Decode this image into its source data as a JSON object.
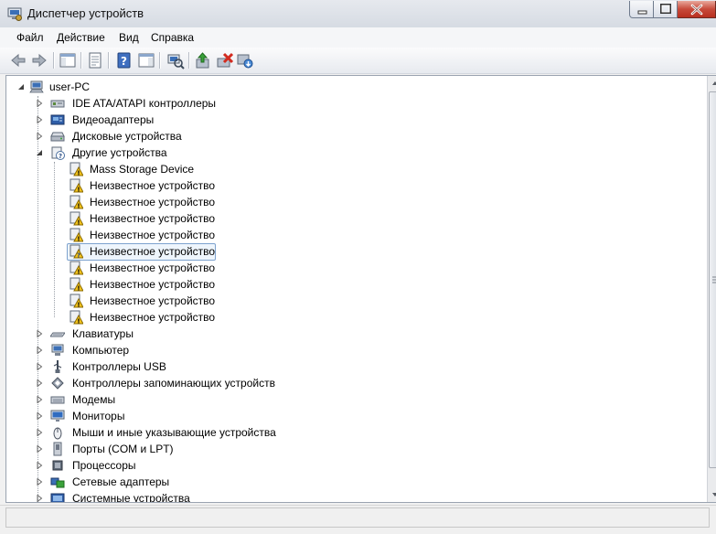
{
  "window": {
    "title": "Диспетчер устройств",
    "accent": "#7da2ce"
  },
  "menu": [
    {
      "label": "Файл"
    },
    {
      "label": "Действие"
    },
    {
      "label": "Вид"
    },
    {
      "label": "Справка"
    }
  ],
  "toolbar": {
    "buttons": [
      {
        "name": "back-button",
        "icon": "arrow-left-icon"
      },
      {
        "name": "forward-button",
        "icon": "arrow-right-icon"
      },
      {
        "name": "show-hide-console-tree-button",
        "icon": "console-tree-icon"
      },
      {
        "name": "properties-button",
        "icon": "properties-icon"
      },
      {
        "name": "help-button",
        "icon": "help-icon"
      },
      {
        "name": "show-action-pane-button",
        "icon": "action-pane-icon"
      },
      {
        "name": "scan-hardware-button",
        "icon": "scan-hardware-icon"
      },
      {
        "name": "update-driver-button",
        "icon": "update-driver-icon"
      },
      {
        "name": "uninstall-button",
        "icon": "uninstall-icon"
      },
      {
        "name": "disable-button",
        "icon": "disable-device-icon"
      }
    ]
  },
  "tree": {
    "root": {
      "label": "user-PC",
      "icon": "computer-icon",
      "expanded": true
    },
    "categories": [
      {
        "label": "IDE ATA/ATAPI контроллеры",
        "icon": "ide-controller-icon",
        "expanded": false
      },
      {
        "label": "Видеоадаптеры",
        "icon": "display-adapter-icon",
        "expanded": false
      },
      {
        "label": "Дисковые устройства",
        "icon": "disk-drive-icon",
        "expanded": false
      },
      {
        "label": "Другие устройства",
        "icon": "unknown-device-icon",
        "expanded": true,
        "children": [
          {
            "label": "Mass Storage Device",
            "icon": "warning-device-icon"
          },
          {
            "label": "Неизвестное устройство",
            "icon": "warning-device-icon"
          },
          {
            "label": "Неизвестное устройство",
            "icon": "warning-device-icon"
          },
          {
            "label": "Неизвестное устройство",
            "icon": "warning-device-icon"
          },
          {
            "label": "Неизвестное устройство",
            "icon": "warning-device-icon"
          },
          {
            "label": "Неизвестное устройство",
            "icon": "warning-device-icon",
            "selected": true
          },
          {
            "label": "Неизвестное устройство",
            "icon": "warning-device-icon"
          },
          {
            "label": "Неизвестное устройство",
            "icon": "warning-device-icon"
          },
          {
            "label": "Неизвестное устройство",
            "icon": "warning-device-icon"
          },
          {
            "label": "Неизвестное устройство",
            "icon": "warning-device-icon"
          }
        ]
      },
      {
        "label": "Клавиатуры",
        "icon": "keyboard-icon",
        "expanded": false
      },
      {
        "label": "Компьютер",
        "icon": "computer-icon",
        "expanded": false
      },
      {
        "label": "Контроллеры USB",
        "icon": "usb-icon",
        "expanded": false
      },
      {
        "label": "Контроллеры запоминающих устройств",
        "icon": "storage-controller-icon",
        "expanded": false
      },
      {
        "label": "Модемы",
        "icon": "modem-icon",
        "expanded": false
      },
      {
        "label": "Мониторы",
        "icon": "monitor-icon",
        "expanded": false
      },
      {
        "label": "Мыши и иные указывающие устройства",
        "icon": "mouse-icon",
        "expanded": false
      },
      {
        "label": "Порты (COM и LPT)",
        "icon": "port-icon",
        "expanded": false
      },
      {
        "label": "Процессоры",
        "icon": "processor-icon",
        "expanded": false
      },
      {
        "label": "Сетевые адаптеры",
        "icon": "network-adapter-icon",
        "expanded": false
      },
      {
        "label": "Системные устройства",
        "icon": "system-device-icon",
        "expanded": false
      }
    ]
  },
  "status": {
    "text": ""
  }
}
